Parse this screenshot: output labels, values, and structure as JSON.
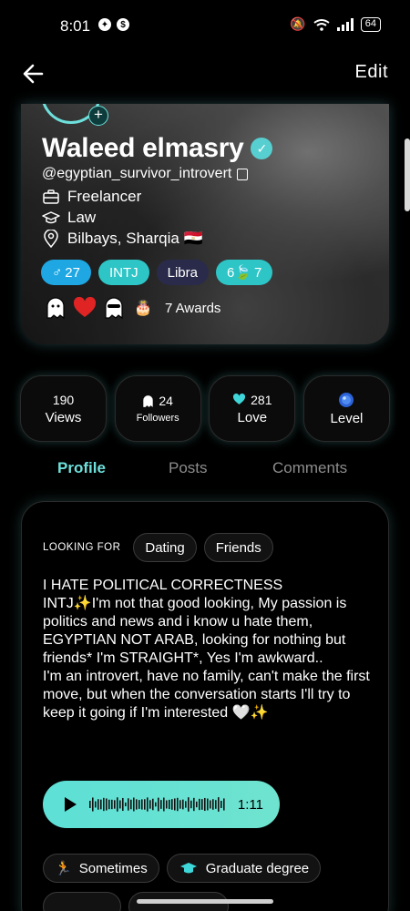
{
  "status": {
    "time": "8:01",
    "battery": "64",
    "left_icons": [
      "snapchat-icon",
      "dollar-icon"
    ],
    "right_icons": [
      "mute-icon",
      "wifi-icon",
      "signal-icon"
    ]
  },
  "top_bar": {
    "edit_label": "Edit"
  },
  "profile": {
    "name": "Waleed elmasry",
    "username": "@egyptian_survivor_introvert",
    "job": "Freelancer",
    "education": "Law",
    "location": "Bilbays, Sharqia 🇪🇬",
    "plus": "+"
  },
  "tags": {
    "gender_age": "27",
    "mbti": "INTJ",
    "zodiac": "Libra",
    "extra": "7"
  },
  "awards": {
    "label": "7 Awards"
  },
  "stats": {
    "views_count": "190",
    "views_label": "Views",
    "followers_count": "24",
    "followers_label": "Followers",
    "love_count": "281",
    "love_label": "Love",
    "level_label": "Level"
  },
  "tabs": {
    "profile": "Profile",
    "posts": "Posts",
    "comments": "Comments"
  },
  "card": {
    "looking_for_label": "LOOKING FOR",
    "looking_for": [
      "Dating",
      "Friends"
    ],
    "bio": "I HATE POLITICAL CORRECTNESS\nINTJ✨I'm not that good looking, My passion is politics and news and i know u hate them, EGYPTIAN NOT ARAB, looking for nothing but friends* I'm STRAIGHT*, Yes I'm awkward..\nI'm an introvert, have no family, can't make the first move, but when the conversation starts I'll try to keep it going if I'm interested 🤍✨",
    "audio_duration": "1:11",
    "attributes": [
      "Sometimes",
      "Graduate degree"
    ]
  },
  "colors": {
    "accent": "#6ee0dc",
    "tag_blue": "#1ea7e3",
    "tag_teal": "#2ec5c6",
    "tag_dark": "#2a2b4a",
    "heart": "#e02424"
  }
}
